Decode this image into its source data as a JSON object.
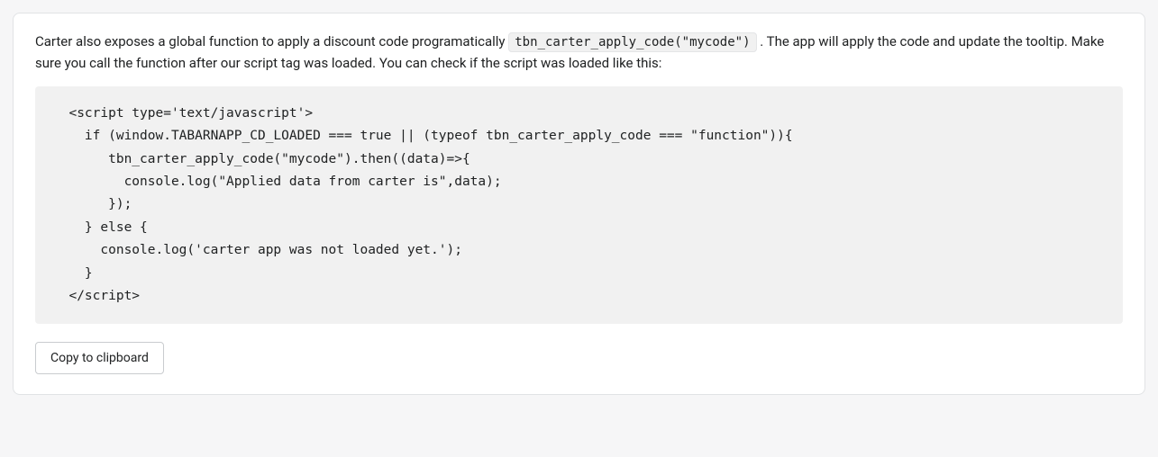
{
  "description": {
    "text_before": "Carter also exposes a global function to apply a discount code programatically ",
    "inline_code": "tbn_carter_apply_code(\"mycode\")",
    "text_after": " . The app will apply the code and update the tooltip. Make sure you call the function after our script tag was loaded. You can check if the script was loaded like this:"
  },
  "code_block": "  <script type='text/javascript'>\n    if (window.TABARNAPP_CD_LOADED === true || (typeof tbn_carter_apply_code === \"function\")){\n       tbn_carter_apply_code(\"mycode\").then((data)=>{\n         console.log(\"Applied data from carter is\",data);\n       });\n    } else {\n      console.log('carter app was not loaded yet.');\n    }\n  </script>",
  "copy_button_label": "Copy to clipboard"
}
